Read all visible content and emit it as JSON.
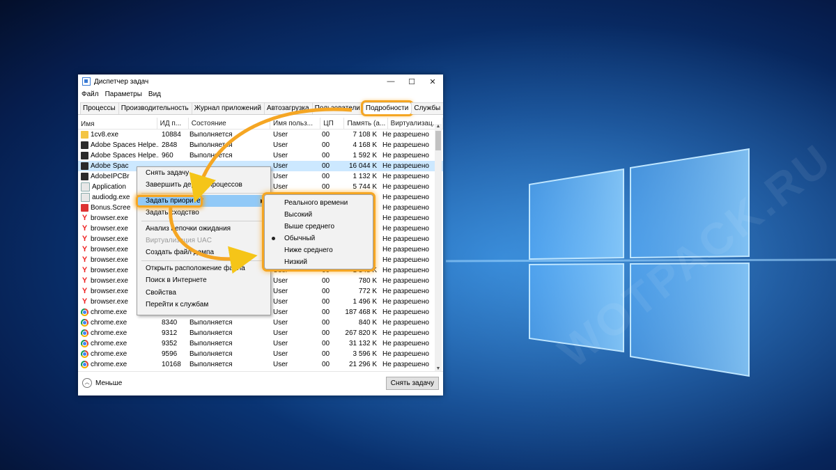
{
  "window": {
    "title": "Диспетчер задач",
    "minimize": "—",
    "maximize": "☐",
    "close": "✕"
  },
  "menu": [
    "Файл",
    "Параметры",
    "Вид"
  ],
  "tabs": [
    "Процессы",
    "Производительность",
    "Журнал приложений",
    "Автозагрузка",
    "Пользователи",
    "Подробности",
    "Службы"
  ],
  "columns": [
    "Имя",
    "ИД п...",
    "Состояние",
    "Имя польз...",
    "ЦП",
    "Память (а...",
    "Виртуализац..."
  ],
  "rows": [
    {
      "name": "1cv8.exe",
      "pid": "10884",
      "state": "Выполняется",
      "user": "User",
      "cpu": "00",
      "mem": "7 108 K",
      "virt": "Не разрешено",
      "icon": "1c-icon"
    },
    {
      "name": "Adobe Spaces Helpe...",
      "pid": "2848",
      "state": "Выполняется",
      "user": "User",
      "cpu": "00",
      "mem": "4 168 K",
      "virt": "Не разрешено",
      "icon": "adobe-icon"
    },
    {
      "name": "Adobe Spaces Helpe...",
      "pid": "960",
      "state": "Выполняется",
      "user": "User",
      "cpu": "00",
      "mem": "1 592 K",
      "virt": "Не разрешено",
      "icon": "adobe-icon"
    },
    {
      "name": "Adobe Spac",
      "pid": "",
      "state": "",
      "user": "User",
      "cpu": "00",
      "mem": "16 044 K",
      "virt": "Не разрешено",
      "icon": "adobe-icon"
    },
    {
      "name": "AdobeIPCBr",
      "pid": "",
      "state": "",
      "user": "User",
      "cpu": "00",
      "mem": "1 132 K",
      "virt": "Не разрешено",
      "icon": "adobe-icon"
    },
    {
      "name": "Application",
      "pid": "",
      "state": "",
      "user": "User",
      "cpu": "00",
      "mem": "5 744 K",
      "virt": "Не разрешено",
      "icon": "window-icon"
    },
    {
      "name": "audiodg.exe",
      "pid": "",
      "state": "",
      "user": "",
      "cpu": "",
      "mem": "",
      "virt": "Не разрешено",
      "icon": "window-icon"
    },
    {
      "name": "Bonus.Scree",
      "pid": "",
      "state": "",
      "user": "",
      "cpu": "",
      "mem": "",
      "virt": "Не разрешено",
      "icon": "red-icon"
    },
    {
      "name": "browser.exe",
      "pid": "",
      "state": "",
      "user": "",
      "cpu": "",
      "mem": "",
      "virt": "Не разрешено",
      "icon": "yandex-icon"
    },
    {
      "name": "browser.exe",
      "pid": "",
      "state": "",
      "user": "",
      "cpu": "",
      "mem": "",
      "virt": "Не разрешено",
      "icon": "yandex-icon"
    },
    {
      "name": "browser.exe",
      "pid": "",
      "state": "",
      "user": "",
      "cpu": "",
      "mem": "",
      "virt": "Не разрешено",
      "icon": "yandex-icon"
    },
    {
      "name": "browser.exe",
      "pid": "",
      "state": "",
      "user": "",
      "cpu": "",
      "mem": "",
      "virt": "Не разрешено",
      "icon": "yandex-icon"
    },
    {
      "name": "browser.exe",
      "pid": "",
      "state": "",
      "user": "",
      "cpu": "",
      "mem": "",
      "virt": "Не разрешено",
      "icon": "yandex-icon"
    },
    {
      "name": "browser.exe",
      "pid": "",
      "state": "",
      "user": "User",
      "cpu": "00",
      "mem": "1 548 K",
      "virt": "Не разрешено",
      "icon": "yandex-icon"
    },
    {
      "name": "browser.exe",
      "pid": "",
      "state": "",
      "user": "User",
      "cpu": "00",
      "mem": "780 K",
      "virt": "Не разрешено",
      "icon": "yandex-icon"
    },
    {
      "name": "browser.exe",
      "pid": "",
      "state": "",
      "user": "User",
      "cpu": "00",
      "mem": "772 K",
      "virt": "Не разрешено",
      "icon": "yandex-icon"
    },
    {
      "name": "browser.exe",
      "pid": "",
      "state": "",
      "user": "User",
      "cpu": "00",
      "mem": "1 496 K",
      "virt": "Не разрешено",
      "icon": "yandex-icon"
    },
    {
      "name": "chrome.exe",
      "pid": "824",
      "state": "Выполняется",
      "user": "User",
      "cpu": "00",
      "mem": "187 468 K",
      "virt": "Не разрешено",
      "icon": "chrome-icon"
    },
    {
      "name": "chrome.exe",
      "pid": "8340",
      "state": "Выполняется",
      "user": "User",
      "cpu": "00",
      "mem": "840 K",
      "virt": "Не разрешено",
      "icon": "chrome-icon"
    },
    {
      "name": "chrome.exe",
      "pid": "9312",
      "state": "Выполняется",
      "user": "User",
      "cpu": "00",
      "mem": "267 820 K",
      "virt": "Не разрешено",
      "icon": "chrome-icon"
    },
    {
      "name": "chrome.exe",
      "pid": "9352",
      "state": "Выполняется",
      "user": "User",
      "cpu": "00",
      "mem": "31 132 K",
      "virt": "Не разрешено",
      "icon": "chrome-icon"
    },
    {
      "name": "chrome.exe",
      "pid": "9596",
      "state": "Выполняется",
      "user": "User",
      "cpu": "00",
      "mem": "3 596 K",
      "virt": "Не разрешено",
      "icon": "chrome-icon"
    },
    {
      "name": "chrome.exe",
      "pid": "10168",
      "state": "Выполняется",
      "user": "User",
      "cpu": "00",
      "mem": "21 296 K",
      "virt": "Не разрешено",
      "icon": "chrome-icon"
    }
  ],
  "footer": {
    "less": "Меньше",
    "end_task": "Снять задачу"
  },
  "context_menu": [
    {
      "label": "Снять задачу",
      "disabled": false
    },
    {
      "label": "Завершить дерево процессов",
      "disabled": false
    },
    {
      "sep": true
    },
    {
      "label": "Задать приоритет",
      "disabled": false,
      "highlight": true,
      "submenu": true
    },
    {
      "label": "Задать сходство",
      "disabled": false
    },
    {
      "sep": true
    },
    {
      "label": "Анализ цепочки ожидания",
      "disabled": false
    },
    {
      "label": "Виртуализация UAC",
      "disabled": true
    },
    {
      "label": "Создать файл дампа",
      "disabled": false
    },
    {
      "sep": true
    },
    {
      "label": "Открыть расположение файла",
      "disabled": false
    },
    {
      "label": "Поиск в Интернете",
      "disabled": false
    },
    {
      "label": "Свойства",
      "disabled": false
    },
    {
      "label": "Перейти к службам",
      "disabled": false
    }
  ],
  "priority_submenu": [
    {
      "label": "Реального времени",
      "checked": false
    },
    {
      "label": "Высокий",
      "checked": false
    },
    {
      "label": "Выше среднего",
      "checked": false
    },
    {
      "label": "Обычный",
      "checked": true
    },
    {
      "label": "Ниже среднего",
      "checked": false
    },
    {
      "label": "Низкий",
      "checked": false
    }
  ],
  "watermark": "WOTPACK.RU",
  "colors": {
    "highlight": "#f5a623",
    "selection": "#cce8ff",
    "menu_hover": "#91c9f7",
    "desktop": "#0b3f86"
  }
}
